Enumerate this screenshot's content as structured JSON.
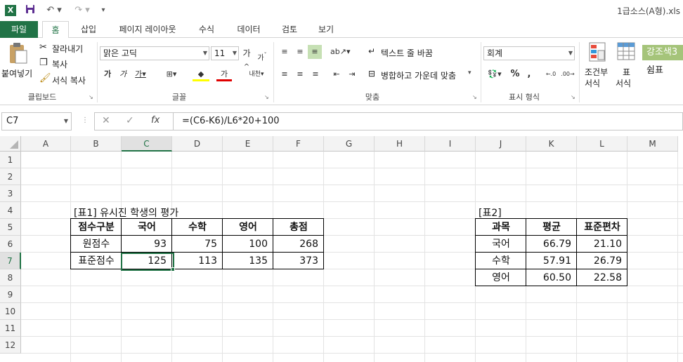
{
  "app": {
    "title": "1급소스(A형).xls"
  },
  "tabs": [
    "파일",
    "홈",
    "삽입",
    "페이지 레이아웃",
    "수식",
    "데이터",
    "검토",
    "보기"
  ],
  "ribbon": {
    "clipboard": {
      "paste": "붙여넣기",
      "cut": "잘라내기",
      "copy": "복사",
      "format_painter": "서식 복사",
      "label": "클립보드"
    },
    "font": {
      "name": "맑은 고딕",
      "size": "11",
      "label": "글꼴"
    },
    "align": {
      "wrap": "텍스트 줄 바꿈",
      "merge": "병합하고 가운데 맞춤",
      "label": "맞춤"
    },
    "number": {
      "format": "회계",
      "label": "표시 형식",
      "percent": "%",
      "comma": ","
    },
    "styles": {
      "cond": "조건부",
      "cond2": "서식",
      "table": "표",
      "table2": "서식",
      "accent": "강조색3",
      "comma_style": "쉼표"
    }
  },
  "formula_bar": {
    "name_box": "C7",
    "formula": "=(C6-K6)/L6*20+100"
  },
  "columns": [
    "A",
    "B",
    "C",
    "D",
    "E",
    "F",
    "G",
    "H",
    "I",
    "J",
    "K",
    "L",
    "M"
  ],
  "rows": [
    "1",
    "2",
    "3",
    "4",
    "5",
    "6",
    "7",
    "8",
    "9",
    "10",
    "11",
    "12"
  ],
  "table1": {
    "title": "[표1] 유시진 학생의 평가",
    "headers": [
      "점수구분",
      "국어",
      "수학",
      "영어",
      "총점"
    ],
    "rows": [
      [
        "원점수",
        "93",
        "75",
        "100",
        "268"
      ],
      [
        "표준점수",
        "125",
        "113",
        "135",
        "373"
      ]
    ]
  },
  "table2": {
    "title": "[표2]",
    "headers": [
      "과목",
      "평균",
      "표준편차"
    ],
    "rows": [
      [
        "국어",
        "66.79",
        "21.10"
      ],
      [
        "수학",
        "57.91",
        "26.79"
      ],
      [
        "영어",
        "60.50",
        "22.58"
      ]
    ]
  }
}
